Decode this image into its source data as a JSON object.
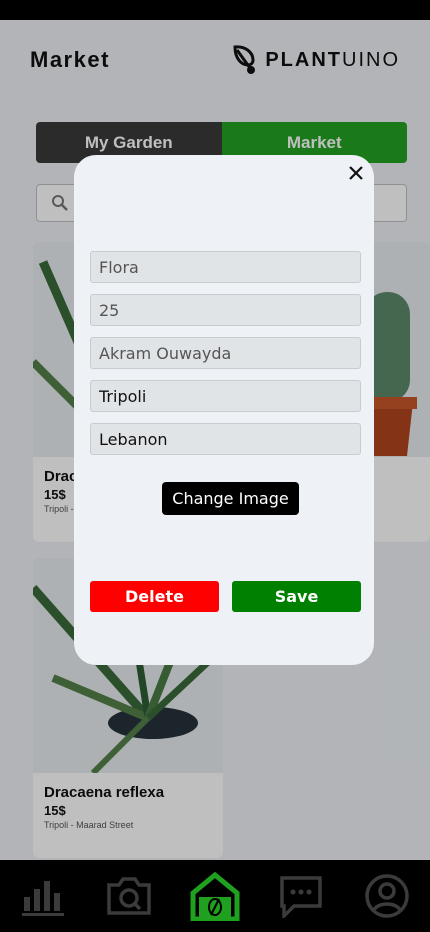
{
  "header": {
    "title": "Market",
    "logo_bold": "PLANT",
    "logo_light": "UINO"
  },
  "tabs": {
    "my_garden": "My Garden",
    "market": "Market"
  },
  "cards": [
    {
      "name": "Dracaena reflexa",
      "price": "15$",
      "location": "Tripoli - Maarad Street"
    },
    {
      "name": "Dracaena reflexa",
      "price": "15$",
      "location": "Tripoli - Maarad Street"
    }
  ],
  "modal": {
    "fields": [
      "Flora",
      "25",
      "Akram Ouwayda",
      "Tripoli",
      "Lebanon"
    ],
    "change_image_label": "Change Image",
    "delete_label": "Delete",
    "save_label": "Save"
  },
  "colors": {
    "accent_green": "#23a323",
    "delete_red": "#ff0000",
    "save_green": "#008000"
  },
  "icons": {
    "nav": [
      "chart-icon",
      "camera-icon",
      "home-leaf-icon",
      "chat-icon",
      "profile-icon"
    ],
    "close": "close-icon",
    "search": "search-icon"
  }
}
